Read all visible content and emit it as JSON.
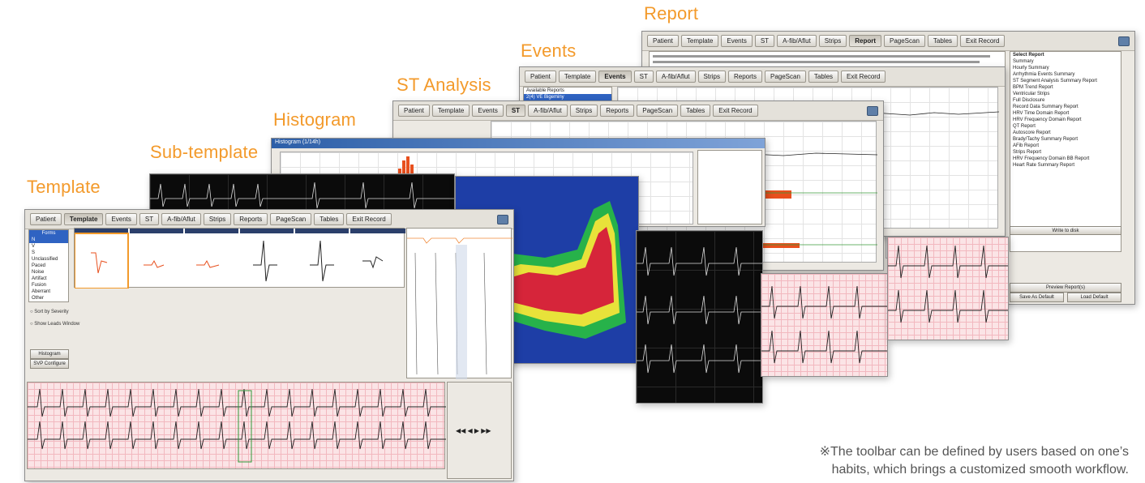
{
  "captions": {
    "template": "Template",
    "subtemplate": "Sub-template",
    "histogram": "Histogram",
    "st_analysis": "ST Analysis",
    "events": "Events",
    "report": "Report"
  },
  "toolbar": {
    "patient": "Patient",
    "template": "Template",
    "events": "Events",
    "st": "ST",
    "arrhythmia": "A-fib/Aflut",
    "strips": "Strips",
    "reports": "Reports",
    "pagescan": "PageScan",
    "tables": "Tables",
    "exit_record": "Exit Record",
    "report": "Report"
  },
  "template_window": {
    "forms_header": "Forms",
    "forms": [
      "N",
      "V",
      "S",
      "Unclassified",
      "Paced",
      "Noise",
      "Artifact",
      "Fusion",
      "Aberrant",
      "Other"
    ],
    "sort_option": "Sort by Severity",
    "show_option": "Show Leads Window",
    "histogram_button": "Histogram",
    "superimpose_button": "SVP Configure"
  },
  "histogram_window": {
    "title": "Histogram (1/14h)"
  },
  "events_window": {
    "list_header": "Available Reports",
    "selected_item": "2(4) VE Bigeminy"
  },
  "report_window": {
    "list_title": "Select Report",
    "items": [
      "Summary",
      "Hourly Summary",
      "Arrhythmia Events Summary",
      "ST Segment Analysis Summary Report",
      "BPM Trend Report",
      "Ventricular Strips",
      "Full Disclosure",
      "Record Data Summary Report",
      "HRV Time Domain Report",
      "HRV Frequency Domain Report",
      "QT Report",
      "Autoscore Report",
      "Brady/Tachy Summary Report",
      "AFib Report",
      "Strips Report",
      "HRV Frequency Domain BB Report",
      "Heart Rate Summary Report"
    ],
    "btn_preview": "Preview Report(s)",
    "btn_save_default": "Save As Default",
    "btn_load_default": "Load Default",
    "btn_write": "Write to disk"
  },
  "note": {
    "line1": "※The toolbar can be defined by users based on one’s",
    "line2": "habits, which brings a customized smooth workflow."
  },
  "colors": {
    "caption": "#f39a2b",
    "accent_blue": "#2f63c2"
  }
}
